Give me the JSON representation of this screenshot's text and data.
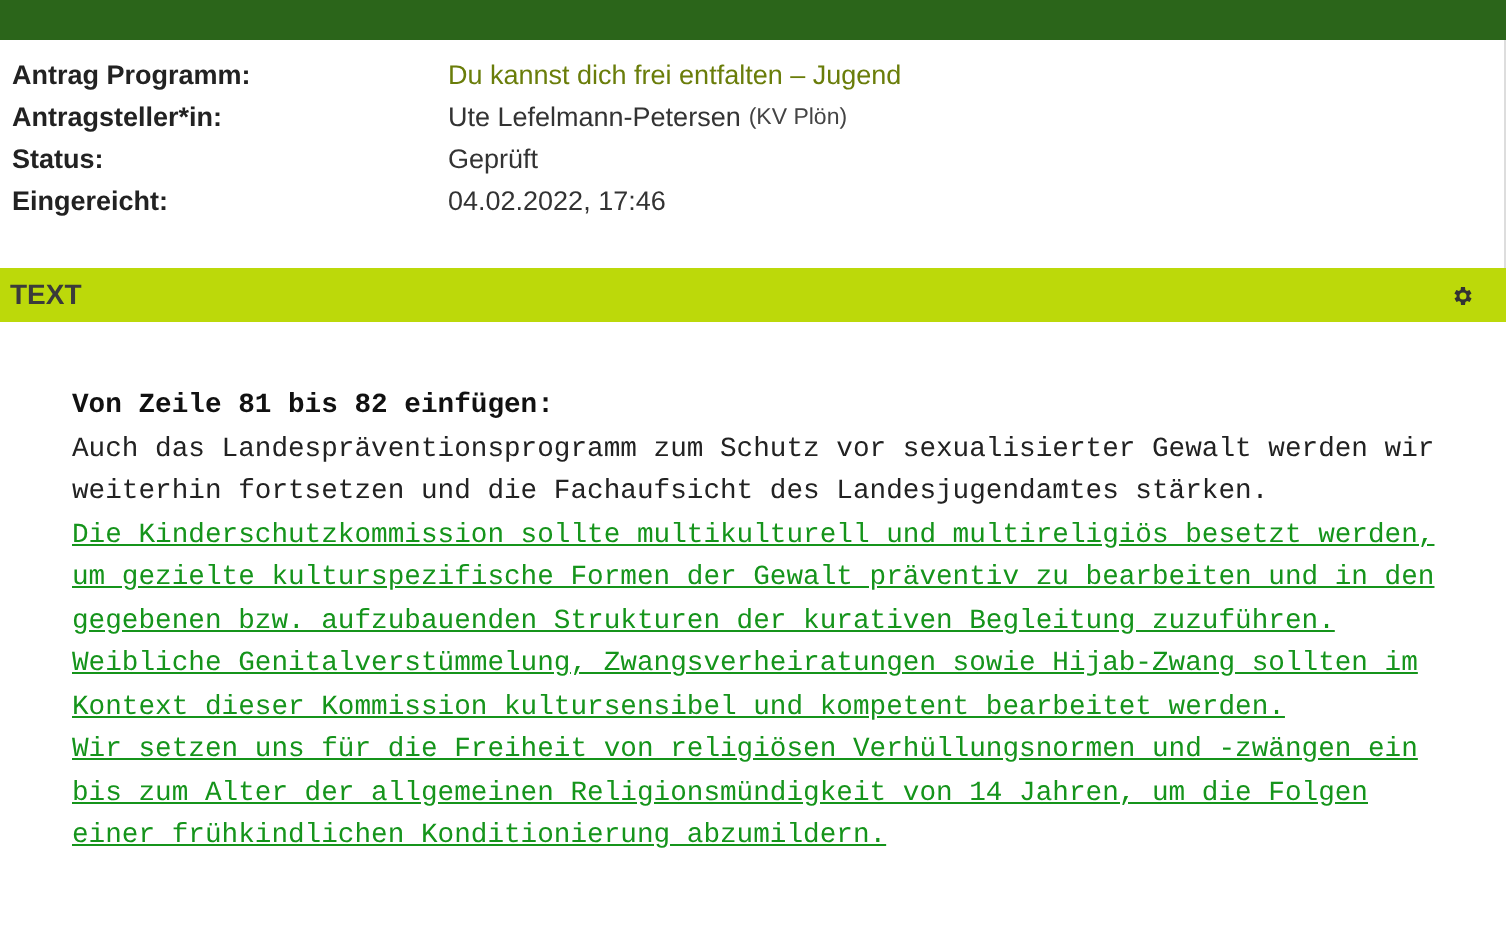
{
  "meta": [
    {
      "label": "Antrag Programm:",
      "value": "Du kannst dich frei entfalten – Jugend",
      "kind": "link"
    },
    {
      "label": "Antragsteller*in:",
      "value": "Ute Lefelmann-Petersen",
      "note": "(KV Plön)",
      "kind": "text"
    },
    {
      "label": "Status:",
      "value": "Geprüft",
      "kind": "text"
    },
    {
      "label": "Eingereicht:",
      "value": "04.02.2022, 17:46",
      "kind": "text"
    }
  ],
  "section": {
    "title": "TEXT"
  },
  "amendment": {
    "heading": "Von Zeile 81 bis 82 einfügen:",
    "paragraphs": [
      {
        "inserted": false,
        "lines": [
          "Auch das Landespräventionsprogramm zum Schutz vor sexualisierter Gewalt werden wir",
          "weiterhin fortsetzen und die Fachaufsicht des Landesjugendamtes stärken."
        ]
      },
      {
        "inserted": true,
        "lines": [
          "Die Kinderschutzkommission sollte multikulturell und multireligiös besetzt werden,",
          "um gezielte kulturspezifische Formen der Gewalt präventiv zu bearbeiten und in den",
          "gegebenen bzw. aufzubauenden Strukturen der kurativen Begleitung zuzuführen."
        ]
      },
      {
        "inserted": true,
        "lines": [
          "Weibliche Genitalverstümmelung, Zwangsverheiratungen sowie Hijab-Zwang sollten im",
          "Kontext dieser Kommission kultursensibel und kompetent bearbeitet werden."
        ]
      },
      {
        "inserted": true,
        "lines": [
          "Wir setzen uns für die Freiheit von religiösen Verhüllungsnormen und -zwängen ein",
          "bis zum Alter der allgemeinen Religionsmündigkeit von 14 Jahren, um die Folgen",
          "einer frühkindlichen Konditionierung abzumildern."
        ]
      }
    ]
  }
}
